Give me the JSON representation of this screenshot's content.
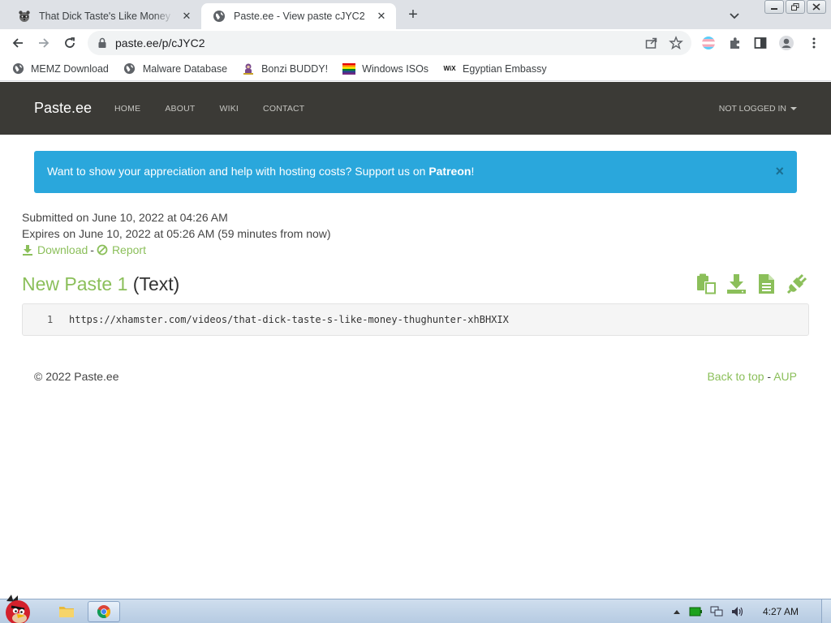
{
  "browser": {
    "tabs": [
      {
        "title": "That Dick Taste's Like Money T",
        "active": false,
        "icon": "raccoon-favicon-icon"
      },
      {
        "title": "Paste.ee - View paste cJYC2",
        "active": true,
        "icon": "globe-icon"
      }
    ],
    "new_tab": "+",
    "address": "paste.ee/p/cJYC2",
    "bookmarks": [
      {
        "label": "MEMZ Download",
        "icon": "globe-icon"
      },
      {
        "label": "Malware Database",
        "icon": "globe-icon"
      },
      {
        "label": "Bonzi BUDDY!",
        "icon": "bonzi-icon"
      },
      {
        "label": "Windows ISOs",
        "icon": "rainbow-flag-icon"
      },
      {
        "label": "Egyptian Embassy",
        "icon": "wix-icon"
      }
    ],
    "wix_text": "WiX"
  },
  "site": {
    "brand": "Paste.ee",
    "nav": [
      "HOME",
      "ABOUT",
      "WIKI",
      "CONTACT"
    ],
    "account": "NOT LOGGED IN"
  },
  "alert": {
    "text": "Want to show your appreciation and help with hosting costs? Support us on ",
    "link": "Patreon",
    "suffix": "!",
    "close": "×"
  },
  "meta": {
    "submitted": "Submitted on June 10, 2022 at 04:26 AM",
    "expires": "Expires on June 10, 2022 at 05:26 AM (59 minutes from now)",
    "download": "Download",
    "separator": "-",
    "report": "Report"
  },
  "paste": {
    "name": "New Paste 1",
    "type": "(Text)",
    "lines": [
      {
        "number": "1",
        "text": "https://xhamster.com/videos/that-dick-taste-s-like-money-thughunter-xhBHXIX"
      }
    ]
  },
  "footer": {
    "copyright": "© 2022 Paste.ee",
    "back_to_top": "Back to top",
    "separator": "-",
    "aup": "AUP"
  },
  "taskbar": {
    "clock": "4:27 AM"
  },
  "colors": {
    "accent_green": "#8bbf5a",
    "alert_blue": "#2aa7dc",
    "nav_bg": "#3b3a36"
  }
}
